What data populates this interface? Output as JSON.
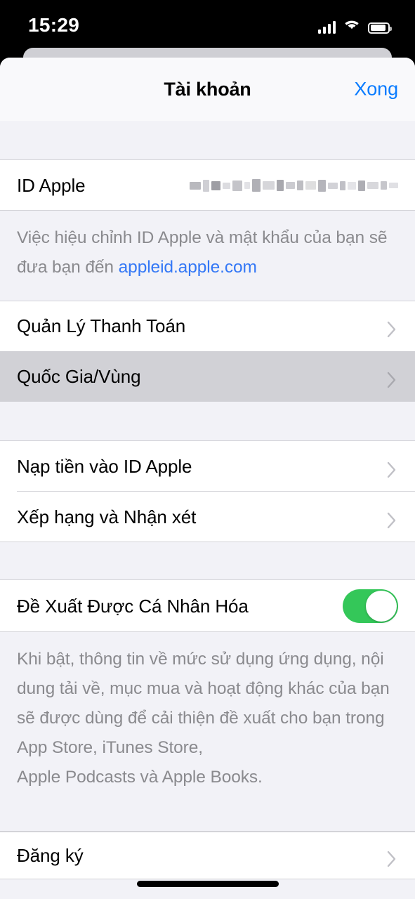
{
  "status_bar": {
    "time": "15:29",
    "signal_icon": "cellular-signal-icon",
    "signal_bars_filled": 4,
    "wifi_icon": "wifi-icon",
    "battery_icon": "battery-icon",
    "battery_level_percent": 88
  },
  "nav": {
    "title": "Tài khoản",
    "done_label": "Xong"
  },
  "sections": {
    "apple_id_row": {
      "label": "ID Apple",
      "value_redacted": true,
      "value_placeholder": "redacted-apple-id"
    },
    "apple_id_footer": {
      "text_before": "Việc hiệu chỉnh ID Apple và mật khẩu của bạn sẽ đưa bạn đến ",
      "link_text": "appleid.apple.com",
      "text_after": ""
    },
    "payment_rows": [
      {
        "label": "Quản Lý Thanh Toán",
        "accessory": "chevron-right-icon",
        "pressed": false
      },
      {
        "label": "Quốc Gia/Vùng",
        "accessory": "chevron-right-icon",
        "pressed": true
      }
    ],
    "account_rows": [
      {
        "label": "Nạp tiền vào ID Apple",
        "accessory": "chevron-right-icon",
        "pressed": false
      },
      {
        "label": "Xếp hạng và Nhận xét",
        "accessory": "chevron-right-icon",
        "pressed": false
      }
    ],
    "personalized": {
      "label": "Đề Xuất Được Cá Nhân Hóa",
      "toggle_state": "on",
      "toggle_on_color": "#34C759"
    },
    "personalized_footer": {
      "text": "Khi bật, thông tin về mức sử dụng ứng dụng, nội dung tải về, mục mua và hoạt động khác của bạn sẽ được dùng để cải thiện đề xuất cho bạn trong App Store, iTunes Store,\nApple Podcasts và Apple Books."
    },
    "subscription_row": {
      "label": "Đăng ký",
      "accessory": "chevron-right-icon"
    }
  },
  "colors": {
    "accent_blue": "#0A7CFF",
    "link_blue": "#3478F6",
    "toggle_green": "#34C759",
    "group_background": "#F2F2F7",
    "row_background": "#FFFFFF",
    "pressed_row": "#D1D1D6",
    "separator": "#D3D3D8",
    "secondary_text": "#8A8A8E",
    "chevron_gray": "#C7C7CC"
  },
  "home_indicator": {
    "visible": true
  }
}
